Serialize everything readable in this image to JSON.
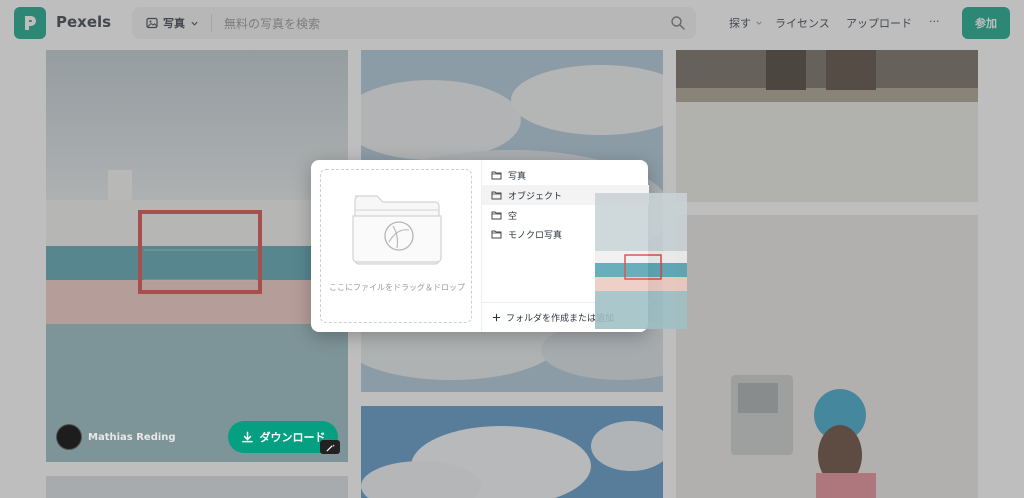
{
  "header": {
    "brand": "Pexels",
    "search_type": "写真",
    "search_placeholder": "無料の写真を検索",
    "nav_explore": "探す",
    "nav_license": "ライセンス",
    "nav_upload": "アップロード",
    "nav_more": "···",
    "join_label": "参加"
  },
  "modal": {
    "drop_text": "ここにファイルをドラッグ＆ドロップ",
    "folders": [
      {
        "label": "写真"
      },
      {
        "label": "オブジェクト"
      },
      {
        "label": "空"
      },
      {
        "label": "モノクロ写真"
      }
    ],
    "create_folder_label": "フォルダを作成または追加"
  },
  "card": {
    "author_name": "Mathias Reding",
    "download_label": "ダウンロード"
  },
  "colors": {
    "accent": "#05a081"
  },
  "icons": {
    "logo": "pexels-logo-icon",
    "photo_type": "image-icon",
    "search": "search-icon",
    "folder": "folder-icon",
    "download": "download-icon"
  }
}
